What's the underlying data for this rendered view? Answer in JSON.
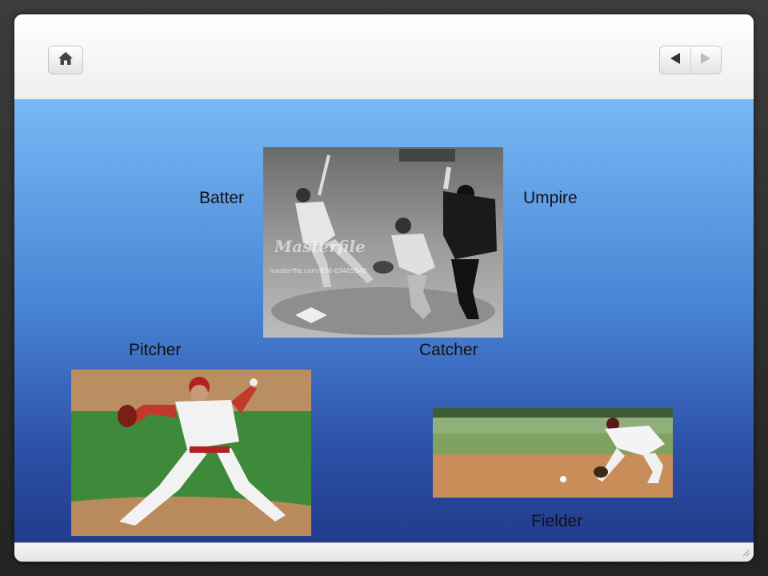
{
  "toolbar": {
    "home_icon": "home-icon",
    "back_icon": "triangle-left-icon",
    "forward_icon": "triangle-right-icon"
  },
  "slide": {
    "labels": {
      "batter": "Batter",
      "umpire": "Umpire",
      "pitcher": "Pitcher",
      "catcher": "Catcher",
      "fielder": "Fielder"
    },
    "watermark": {
      "brand": "Masterfile",
      "url": "masterfile.com/836-03485549"
    }
  },
  "colors": {
    "stage_top": "#78b8f4",
    "stage_bottom": "#223b8c"
  }
}
